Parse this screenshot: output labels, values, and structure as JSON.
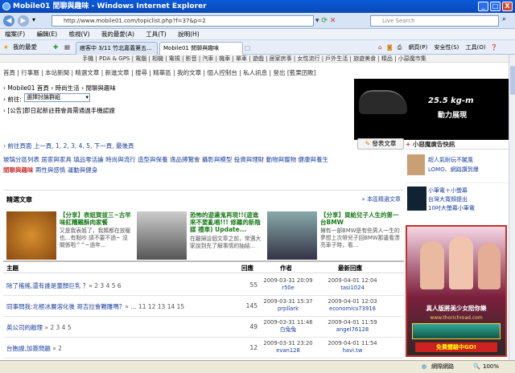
{
  "window": {
    "title": "Mobile01 閒聊與趣味 - Windows Internet Explorer",
    "minimize": "_",
    "maximize": "□",
    "close": "X"
  },
  "address": {
    "url": "http://www.mobile01.com/topiclist.php?f=37&p=2",
    "search_placeholder": "Live Search"
  },
  "menu": [
    "檔案(F)",
    "編輯(E)",
    "檢視(V)",
    "我的最愛(A)",
    "工具(T)",
    "說明(H)"
  ],
  "favbar": {
    "favorites": "我的最愛",
    "tabs": [
      "痞客中 3/11 竹北嘉義第五...",
      "Mobile01 閒聊與趣味"
    ],
    "commands": [
      "網頁(P)",
      "安全性(S)",
      "工具(O)"
    ]
  },
  "site": {
    "topnav": "手機  |  PDA & GPS  |  電腦  |  相機  |  電視  |  影音  |  汽車  |  機車  |  單車  |  遊戲  |  居家房事  |  女性流行  |  戶外生活  |  旅遊美食  |  精品  |  小惡魔市集",
    "subnav": "首頁 | 行事曆 | 本站新聞 | 精選文章 | 新進文章 | 搜尋 | 精華區 | 我的文章 | 個人控制台 | 私人訊息 | 登出 [藍果囝敗]",
    "breadcrumb": "› Mobile01 首頁 › 時尚生活 › 閒聊與趣味",
    "goto_label": "› 前往:",
    "goto_select": "選擇討論群組",
    "notice": "› [公告]即日起新註冊會員需通過手機認證",
    "pager": "› 前往頁面 上一頁, 1, 2, 3, 4, 5, 下一頁, 最後頁",
    "post_button": "發表文章",
    "categories": [
      "玻璃分區列表",
      "居家與家具",
      "填品零活論",
      "時尚與流行",
      "造型與保養",
      "逸品搏覽會",
      "攝影與模型",
      "投資與理財",
      "動物與寵物",
      "健康與養生",
      "閒聊與趣味",
      "兩性與感情",
      "運動與健身"
    ],
    "car_banner": {
      "line1": "25.5 kg-m",
      "line2": "動力展現"
    },
    "side_ad_title": "小惡魔廣告快訊",
    "side_ads": [
      {
        "line1": "超人氣耐玩不膩風",
        "line2": "LOMO、網路讚到爆"
      },
      {
        "line1": "小筆電＋小螢幕",
        "line2": "台灣大寬頻提出",
        "line3": "10吋大螢幕小筆電"
      }
    ],
    "right_ad": {
      "line1": "真人版將美少女陪你樂",
      "line2": "免費體驗中GO!",
      "url": "www.thorichroad.com"
    }
  },
  "featured": {
    "heading": "精選文章",
    "more": "» 本區精選文章",
    "items": [
      {
        "title": "【分享】表姐賀拔三~古早味紅糟雞酥肉家餐",
        "text": "又是我表姐了，我媽都在放暖也…有點吵 請不要不過~ 沒關係啦^^~過年..."
      },
      {
        "title": "恐怖的遊盪鬼再現!!(遊進來不要亂唱!!! 修羅的新陰謀 禮車) Update...",
        "text": "在離掃這個文章之前，常遇大家說到先了解事情的抽結..."
      },
      {
        "title": "【分享】買給兒子人生的第一台BMW",
        "text": "擁有一部BMW是有些男人一生的夢想上次帶兒子回BMW那邊看漂亮車子時，看..."
      }
    ]
  },
  "table": {
    "headers": [
      "主題",
      "回應",
      "作者",
      "最新回應"
    ],
    "rows": [
      {
        "title": "除了搖搖,還有誰是童顏巨乳 ？",
        "pages": "» 2 3 4 5 6",
        "replies": "55",
        "date": "2009-03-31 20:09",
        "author": "r50e",
        "last_date": "2009-04-01 12:04",
        "last_author": "tasi1024"
      },
      {
        "title": "同事問我:北極冰層溶化後 哥吉拉會難雕嗎？",
        "pages": "» ... 11 12 13 14 15",
        "replies": "145",
        "date": "2009-03-31 15:37",
        "author": "prpllark",
        "last_date": "2009-04-01 12:03",
        "last_author": "economics73918"
      },
      {
        "title": "英公司的敵理",
        "pages": "» 2 3 4 5",
        "replies": "49",
        "date": "2009-03-31 11:46",
        "author": "白兔兔",
        "last_date": "2009-04-01 11:59",
        "last_author": "angel76128"
      },
      {
        "title": "台胞證,加簽問題",
        "pages": "» 2",
        "replies": "12",
        "date": "2009-03-31 23:20",
        "author": "evan128",
        "last_date": "2009-04-01 11:54",
        "last_author": "havi.tw"
      }
    ]
  },
  "status": {
    "left": "",
    "zone": "網際網路",
    "zoom": "100%"
  }
}
